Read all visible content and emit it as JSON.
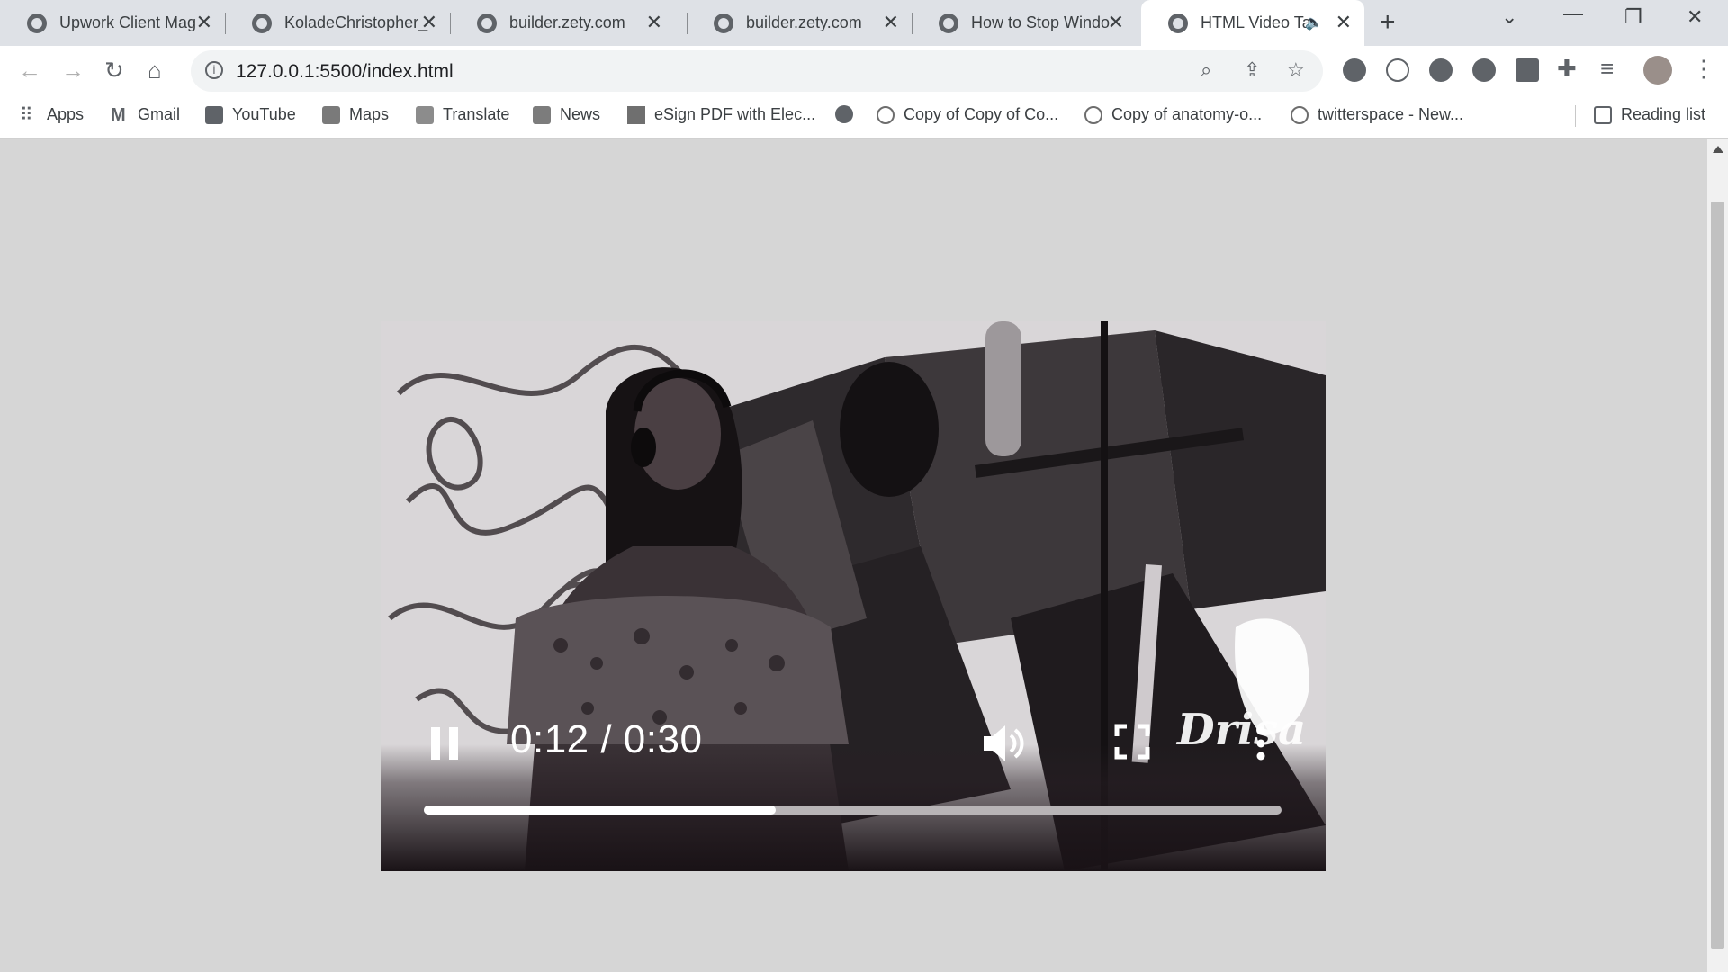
{
  "tabs": [
    {
      "title": "Upwork Client Mag"
    },
    {
      "title": "KoladeChristopher_"
    },
    {
      "title": "builder.zety.com"
    },
    {
      "title": "builder.zety.com"
    },
    {
      "title": "How to Stop Windo"
    },
    {
      "title": "HTML Video Ta",
      "active": true,
      "audio": true
    }
  ],
  "address_bar": {
    "url": "127.0.0.1:5500/index.html"
  },
  "bookmarks": [
    {
      "label": "Apps"
    },
    {
      "label": "Gmail"
    },
    {
      "label": "YouTube"
    },
    {
      "label": "Maps"
    },
    {
      "label": "Translate"
    },
    {
      "label": "News"
    },
    {
      "label": "eSign PDF with Elec..."
    },
    {
      "label": ""
    },
    {
      "label": "Copy of Copy of Co..."
    },
    {
      "label": "Copy of anatomy-o..."
    },
    {
      "label": "twitterspace - New..."
    }
  ],
  "reading_list": {
    "label": "Reading list"
  },
  "video": {
    "current_time": "0:12",
    "duration": "0:30",
    "time_display": "0:12 / 0:30",
    "progress_fraction": 0.41,
    "state": "playing",
    "watermark": "Drisa"
  }
}
